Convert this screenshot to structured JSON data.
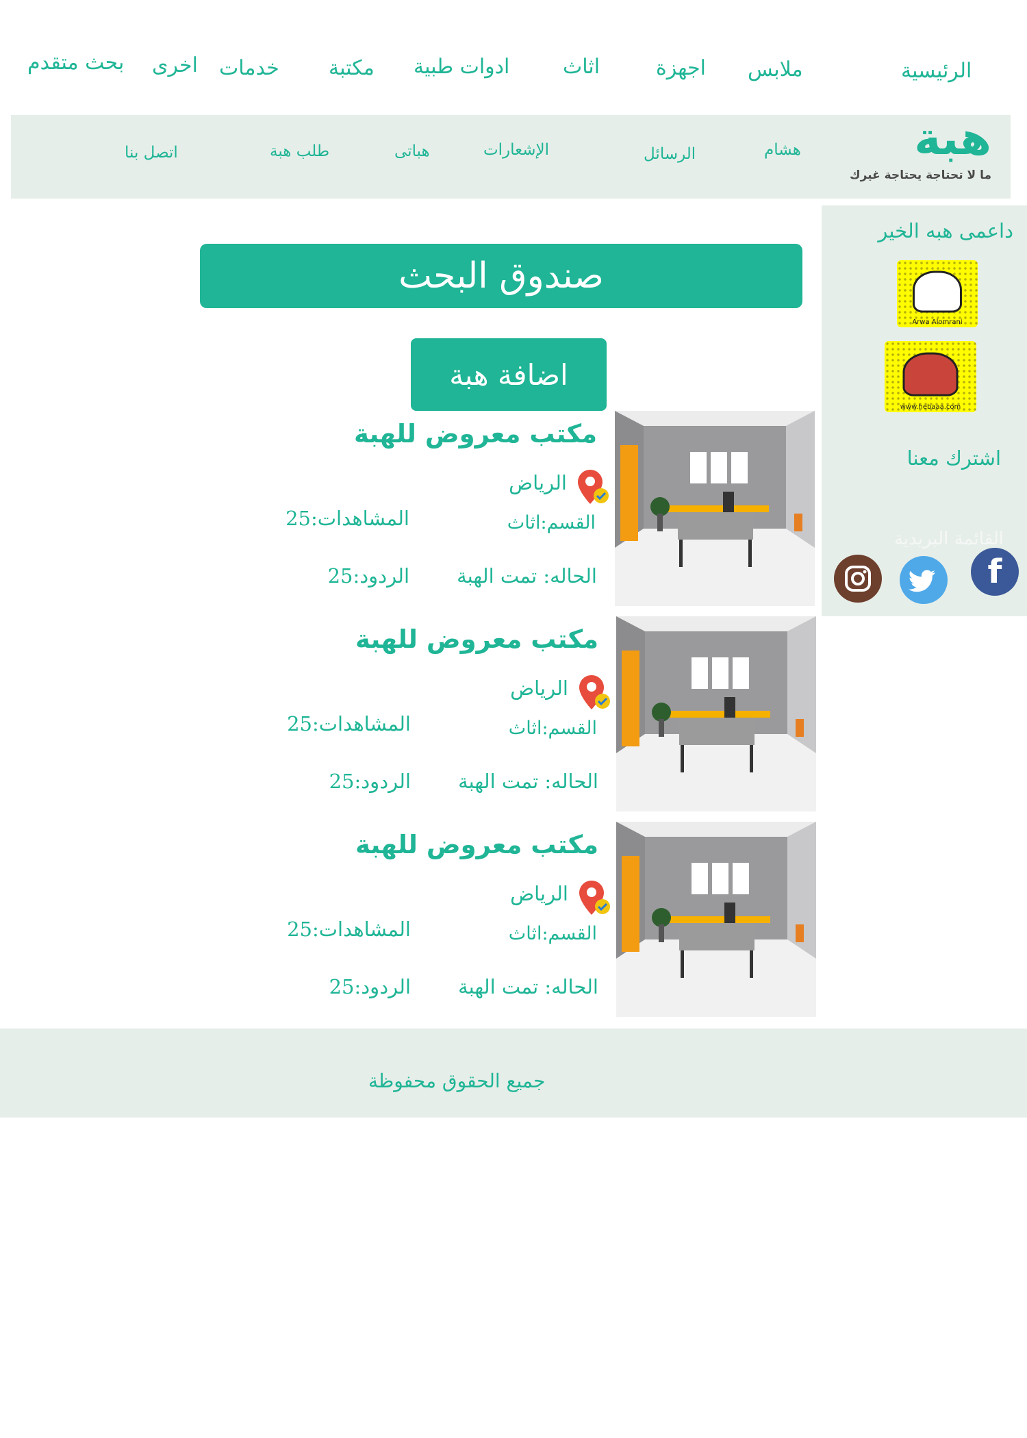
{
  "top_nav": [
    "الرئيسية",
    "ملابس",
    "اجهزة",
    "اثاث",
    "ادوات طبية",
    "مكتبة",
    "خدمات",
    "اخرى",
    "بحث متقدم"
  ],
  "brand": {
    "name": "هبة",
    "tagline": "ما لا تحتاجة يحتاجة غيرك"
  },
  "sub_nav": [
    "هشام",
    "الرسائل",
    "الإشعارات",
    "هباتى",
    "طلب هبة",
    "اتصل بنا"
  ],
  "sidebar": {
    "title": "داعمى هبه الخير",
    "sponsors": [
      {
        "caption": "Arwa Alomrani"
      },
      {
        "caption": "www.hebaaa.com"
      }
    ],
    "subscribe": "اشترك معنا",
    "faded_text": "القائمة البريدية",
    "social": {
      "facebook": "f",
      "twitter": "twitter",
      "instagram": "instagram"
    }
  },
  "search_banner": "صندوق البحث",
  "add_button": "اضافة هبة",
  "listings": [
    {
      "title": "مكتب معروض للهبة",
      "location": "الرياض",
      "category": "القسم:اثاث",
      "views": "المشاهدات:25",
      "status": "الحاله: تمت الهبة",
      "replies": "الردود:25"
    },
    {
      "title": "مكتب معروض للهبة",
      "location": "الرياض",
      "category": "القسم:اثاث",
      "views": "المشاهدات:25",
      "status": "الحاله: تمت الهبة",
      "replies": "الردود:25"
    },
    {
      "title": "مكتب معروض للهبة",
      "location": "الرياض",
      "category": "القسم:اثاث",
      "views": "المشاهدات:25",
      "status": "الحاله: تمت الهبة",
      "replies": "الردود:25"
    }
  ],
  "footer": "جميع الحقوق محفوظة",
  "colors": {
    "accent": "#1fb596",
    "band": "#e6eee9"
  }
}
